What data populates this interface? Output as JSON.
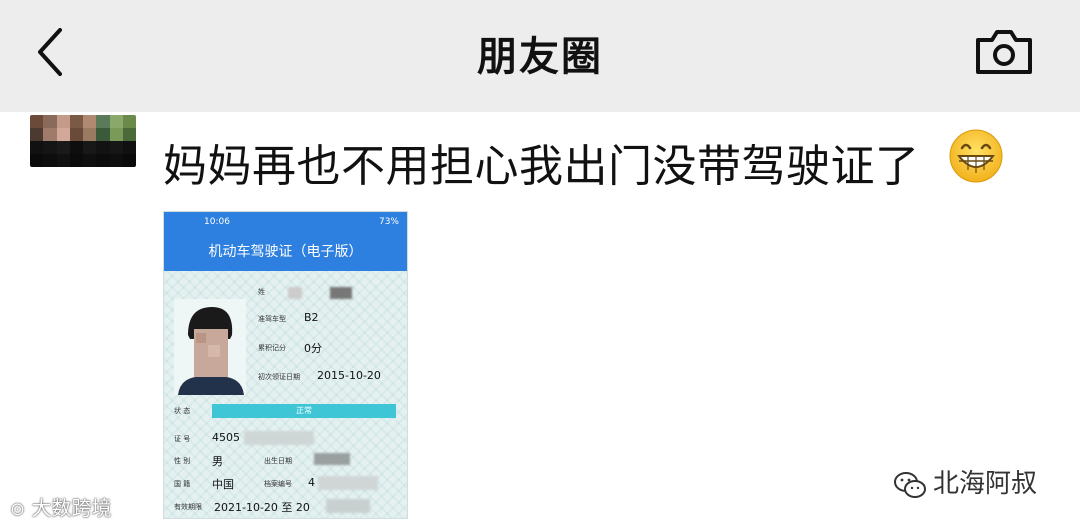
{
  "header": {
    "title": "朋友圈",
    "back_icon": "back-chevron-icon",
    "camera_icon": "camera-icon"
  },
  "post": {
    "text": "妈妈再也不用担心我出门没带驾驶证了",
    "emoji": "grinning-face-icon"
  },
  "license_screenshot": {
    "status_time": "10:06",
    "status_right": "73%",
    "header": "机动车驾驶证（电子版）",
    "rows": [
      {
        "label": "姓",
        "value": ""
      },
      {
        "label": "准驾车型",
        "value": "B2"
      },
      {
        "label": "累积记分",
        "value": "0分"
      },
      {
        "label": "初次领证日期",
        "value": "2015-10-20"
      }
    ],
    "status_label": "状 态",
    "status_value": "正常",
    "id_label": "证 号",
    "id_value": "4505",
    "gender_label": "性 别",
    "gender_value": "男",
    "birth_label": "出生日期",
    "nation_label": "国 籍",
    "nation_value": "中国",
    "file_label": "档案编号",
    "file_value": "4",
    "valid_label": "有效期限",
    "valid_value": "2021-10-20 至 20"
  },
  "watermarks": {
    "left": "大数跨境",
    "right": "北海阿叔"
  },
  "colors": {
    "topbar": "#ededed",
    "license_blue": "#2d7fe0",
    "status_teal": "#3fc6d6"
  }
}
